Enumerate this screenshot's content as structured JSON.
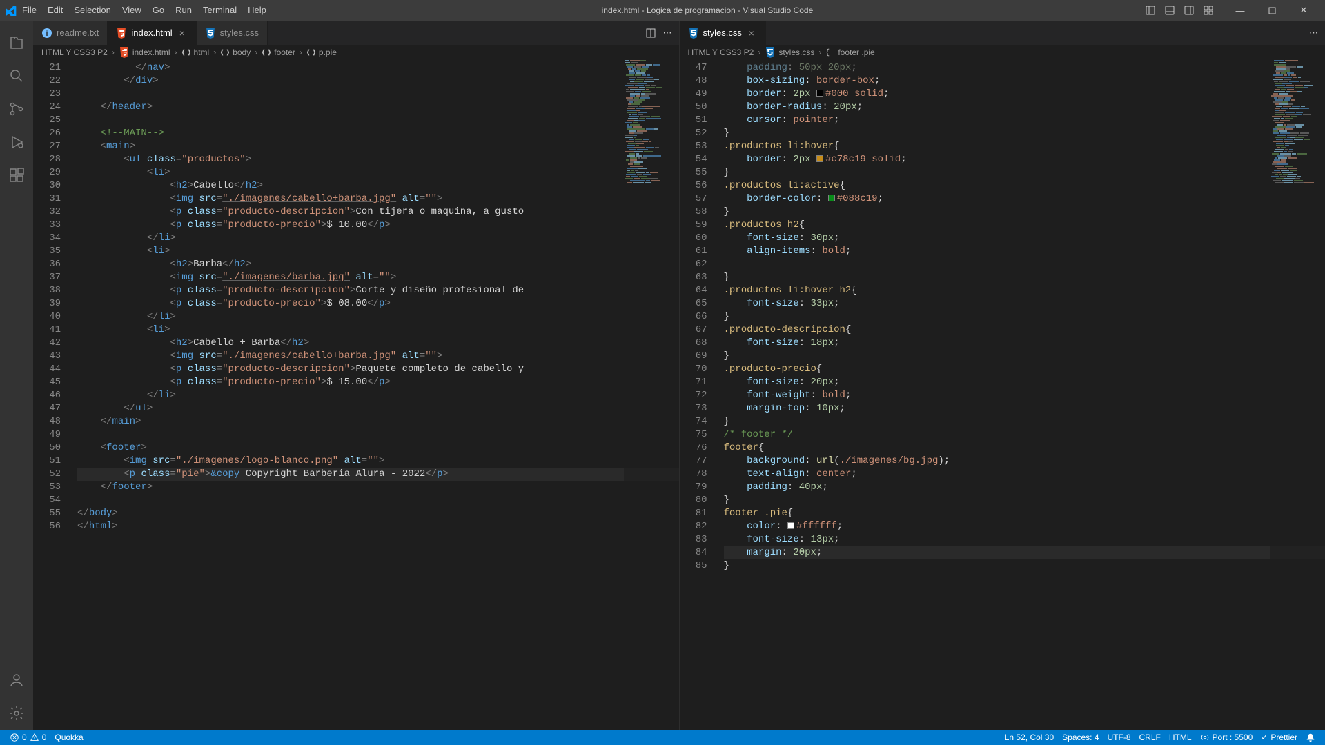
{
  "titleBar": {
    "menus": [
      "File",
      "Edit",
      "Selection",
      "View",
      "Go",
      "Run",
      "Terminal",
      "Help"
    ],
    "windowTitle": "index.html - Logica de programacion - Visual Studio Code"
  },
  "leftPane": {
    "tabs": [
      {
        "icon": "info",
        "label": "readme.txt",
        "active": false,
        "close": false
      },
      {
        "icon": "html",
        "label": "index.html",
        "active": true,
        "close": true
      },
      {
        "icon": "css",
        "label": "styles.css",
        "active": false,
        "close": false
      }
    ],
    "breadcrumbs": [
      "HTML Y CSS3 P2",
      "index.html",
      "html",
      "body",
      "footer",
      "p.pie"
    ],
    "lines": [
      {
        "n": 21,
        "t": "          </nav>"
      },
      {
        "n": 22,
        "t": "        </div>"
      },
      {
        "n": 23,
        "t": ""
      },
      {
        "n": 24,
        "t": "    </header>"
      },
      {
        "n": 25,
        "t": ""
      },
      {
        "n": 26,
        "t": "    <!--MAIN-->"
      },
      {
        "n": 27,
        "t": "    <main>"
      },
      {
        "n": 28,
        "t": "        <ul class=\"productos\">"
      },
      {
        "n": 29,
        "t": "            <li>"
      },
      {
        "n": 30,
        "t": "                <h2>Cabello</h2>"
      },
      {
        "n": 31,
        "t": "                <img src=\"./imagenes/cabello+barba.jpg\" alt=\"\">"
      },
      {
        "n": 32,
        "t": "                <p class=\"producto-descripcion\">Con tijera o maquina, a gusto"
      },
      {
        "n": 33,
        "t": "                <p class=\"producto-precio\">$ 10.00</p>"
      },
      {
        "n": 34,
        "t": "            </li>"
      },
      {
        "n": 35,
        "t": "            <li>"
      },
      {
        "n": 36,
        "t": "                <h2>Barba</h2>"
      },
      {
        "n": 37,
        "t": "                <img src=\"./imagenes/barba.jpg\" alt=\"\">"
      },
      {
        "n": 38,
        "t": "                <p class=\"producto-descripcion\">Corte y diseño profesional de"
      },
      {
        "n": 39,
        "t": "                <p class=\"producto-precio\">$ 08.00</p>"
      },
      {
        "n": 40,
        "t": "            </li>"
      },
      {
        "n": 41,
        "t": "            <li>"
      },
      {
        "n": 42,
        "t": "                <h2>Cabello + Barba</h2>"
      },
      {
        "n": 43,
        "t": "                <img src=\"./imagenes/cabello+barba.jpg\" alt=\"\">"
      },
      {
        "n": 44,
        "t": "                <p class=\"producto-descripcion\">Paquete completo de cabello y"
      },
      {
        "n": 45,
        "t": "                <p class=\"producto-precio\">$ 15.00</p>"
      },
      {
        "n": 46,
        "t": "            </li>"
      },
      {
        "n": 47,
        "t": "        </ul>"
      },
      {
        "n": 48,
        "t": "    </main>"
      },
      {
        "n": 49,
        "t": ""
      },
      {
        "n": 50,
        "t": "    <footer>"
      },
      {
        "n": 51,
        "t": "        <img src=\"./imagenes/logo-blanco.png\" alt=\"\">"
      },
      {
        "n": 52,
        "t": "        <p class=\"pie\">&copy Copyright Barberia Alura - 2022</p>",
        "hl": true
      },
      {
        "n": 53,
        "t": "    </footer>"
      },
      {
        "n": 54,
        "t": ""
      },
      {
        "n": 55,
        "t": "</body>"
      },
      {
        "n": 56,
        "t": "</html>"
      }
    ]
  },
  "rightPane": {
    "tabs": [
      {
        "icon": "css",
        "label": "styles.css",
        "active": true,
        "close": true
      }
    ],
    "breadcrumbs": [
      "HTML Y CSS3 P2",
      "styles.css",
      "footer .pie"
    ],
    "lines": [
      {
        "n": 47,
        "t": "    padding: 50px 20px;",
        "dim": true
      },
      {
        "n": 48,
        "t": "    box-sizing: border-box;"
      },
      {
        "n": 49,
        "t": "    border: 2px #000 solid;",
        "swatch": "#000000"
      },
      {
        "n": 50,
        "t": "    border-radius: 20px;"
      },
      {
        "n": 51,
        "t": "    cursor: pointer;"
      },
      {
        "n": 52,
        "t": "}"
      },
      {
        "n": 53,
        "t": ".productos li:hover{"
      },
      {
        "n": 54,
        "t": "    border: 2px #c78c19 solid;",
        "swatch": "#c78c19"
      },
      {
        "n": 55,
        "t": "}"
      },
      {
        "n": 56,
        "t": ".productos li:active{"
      },
      {
        "n": 57,
        "t": "    border-color: #088c19;",
        "swatch": "#088c19"
      },
      {
        "n": 58,
        "t": "}"
      },
      {
        "n": 59,
        "t": ".productos h2{"
      },
      {
        "n": 60,
        "t": "    font-size: 30px;"
      },
      {
        "n": 61,
        "t": "    align-items: bold;"
      },
      {
        "n": 62,
        "t": ""
      },
      {
        "n": 63,
        "t": "}"
      },
      {
        "n": 64,
        "t": ".productos li:hover h2{"
      },
      {
        "n": 65,
        "t": "    font-size: 33px;"
      },
      {
        "n": 66,
        "t": "}"
      },
      {
        "n": 67,
        "t": ".producto-descripcion{"
      },
      {
        "n": 68,
        "t": "    font-size: 18px;"
      },
      {
        "n": 69,
        "t": "}"
      },
      {
        "n": 70,
        "t": ".producto-precio{"
      },
      {
        "n": 71,
        "t": "    font-size: 20px;"
      },
      {
        "n": 72,
        "t": "    font-weight: bold;"
      },
      {
        "n": 73,
        "t": "    margin-top: 10px;"
      },
      {
        "n": 74,
        "t": "}"
      },
      {
        "n": 75,
        "t": "/* footer */"
      },
      {
        "n": 76,
        "t": "footer{"
      },
      {
        "n": 77,
        "t": "    background: url(./imagenes/bg.jpg);"
      },
      {
        "n": 78,
        "t": "    text-align: center;"
      },
      {
        "n": 79,
        "t": "    padding: 40px;"
      },
      {
        "n": 80,
        "t": "}"
      },
      {
        "n": 81,
        "t": "footer .pie{"
      },
      {
        "n": 82,
        "t": "    color: #ffffff;",
        "swatch": "#ffffff"
      },
      {
        "n": 83,
        "t": "    font-size: 13px;"
      },
      {
        "n": 84,
        "t": "    margin: 20px;",
        "hl": true
      },
      {
        "n": 85,
        "t": "}"
      }
    ]
  },
  "statusBar": {
    "left": [
      {
        "icon": "error",
        "text": "0"
      },
      {
        "icon": "warn",
        "text": "0"
      },
      {
        "text": "Quokka"
      }
    ],
    "right": [
      {
        "text": "Ln 52, Col 30"
      },
      {
        "text": "Spaces: 4"
      },
      {
        "text": "UTF-8"
      },
      {
        "text": "CRLF"
      },
      {
        "text": "HTML"
      },
      {
        "icon": "broadcast",
        "text": "Port : 5500"
      },
      {
        "icon": "check",
        "text": "Prettier"
      },
      {
        "icon": "bell"
      }
    ]
  }
}
